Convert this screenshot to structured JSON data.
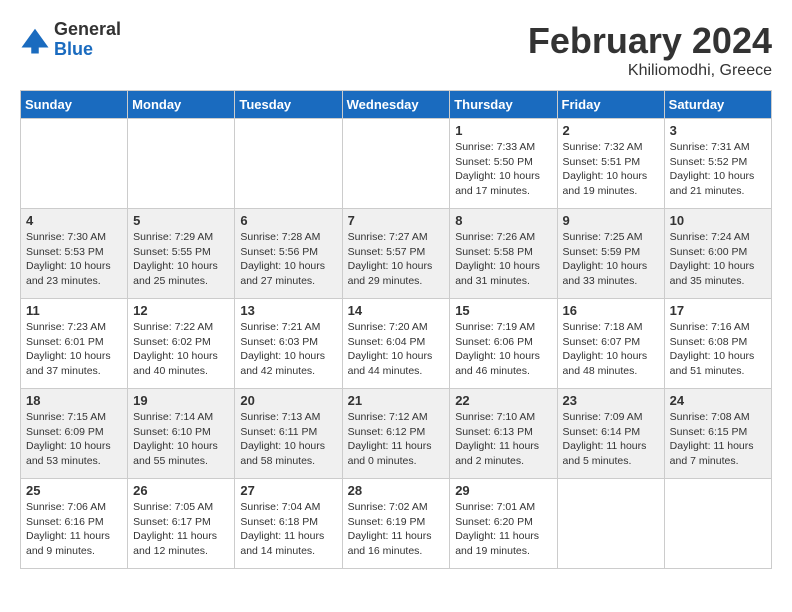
{
  "header": {
    "logo_general": "General",
    "logo_blue": "Blue",
    "month_year": "February 2024",
    "location": "Khiliomodhi, Greece"
  },
  "weekdays": [
    "Sunday",
    "Monday",
    "Tuesday",
    "Wednesday",
    "Thursday",
    "Friday",
    "Saturday"
  ],
  "weeks": [
    [
      {
        "day": "",
        "info": ""
      },
      {
        "day": "",
        "info": ""
      },
      {
        "day": "",
        "info": ""
      },
      {
        "day": "",
        "info": ""
      },
      {
        "day": "1",
        "info": "Sunrise: 7:33 AM\nSunset: 5:50 PM\nDaylight: 10 hours\nand 17 minutes."
      },
      {
        "day": "2",
        "info": "Sunrise: 7:32 AM\nSunset: 5:51 PM\nDaylight: 10 hours\nand 19 minutes."
      },
      {
        "day": "3",
        "info": "Sunrise: 7:31 AM\nSunset: 5:52 PM\nDaylight: 10 hours\nand 21 minutes."
      }
    ],
    [
      {
        "day": "4",
        "info": "Sunrise: 7:30 AM\nSunset: 5:53 PM\nDaylight: 10 hours\nand 23 minutes."
      },
      {
        "day": "5",
        "info": "Sunrise: 7:29 AM\nSunset: 5:55 PM\nDaylight: 10 hours\nand 25 minutes."
      },
      {
        "day": "6",
        "info": "Sunrise: 7:28 AM\nSunset: 5:56 PM\nDaylight: 10 hours\nand 27 minutes."
      },
      {
        "day": "7",
        "info": "Sunrise: 7:27 AM\nSunset: 5:57 PM\nDaylight: 10 hours\nand 29 minutes."
      },
      {
        "day": "8",
        "info": "Sunrise: 7:26 AM\nSunset: 5:58 PM\nDaylight: 10 hours\nand 31 minutes."
      },
      {
        "day": "9",
        "info": "Sunrise: 7:25 AM\nSunset: 5:59 PM\nDaylight: 10 hours\nand 33 minutes."
      },
      {
        "day": "10",
        "info": "Sunrise: 7:24 AM\nSunset: 6:00 PM\nDaylight: 10 hours\nand 35 minutes."
      }
    ],
    [
      {
        "day": "11",
        "info": "Sunrise: 7:23 AM\nSunset: 6:01 PM\nDaylight: 10 hours\nand 37 minutes."
      },
      {
        "day": "12",
        "info": "Sunrise: 7:22 AM\nSunset: 6:02 PM\nDaylight: 10 hours\nand 40 minutes."
      },
      {
        "day": "13",
        "info": "Sunrise: 7:21 AM\nSunset: 6:03 PM\nDaylight: 10 hours\nand 42 minutes."
      },
      {
        "day": "14",
        "info": "Sunrise: 7:20 AM\nSunset: 6:04 PM\nDaylight: 10 hours\nand 44 minutes."
      },
      {
        "day": "15",
        "info": "Sunrise: 7:19 AM\nSunset: 6:06 PM\nDaylight: 10 hours\nand 46 minutes."
      },
      {
        "day": "16",
        "info": "Sunrise: 7:18 AM\nSunset: 6:07 PM\nDaylight: 10 hours\nand 48 minutes."
      },
      {
        "day": "17",
        "info": "Sunrise: 7:16 AM\nSunset: 6:08 PM\nDaylight: 10 hours\nand 51 minutes."
      }
    ],
    [
      {
        "day": "18",
        "info": "Sunrise: 7:15 AM\nSunset: 6:09 PM\nDaylight: 10 hours\nand 53 minutes."
      },
      {
        "day": "19",
        "info": "Sunrise: 7:14 AM\nSunset: 6:10 PM\nDaylight: 10 hours\nand 55 minutes."
      },
      {
        "day": "20",
        "info": "Sunrise: 7:13 AM\nSunset: 6:11 PM\nDaylight: 10 hours\nand 58 minutes."
      },
      {
        "day": "21",
        "info": "Sunrise: 7:12 AM\nSunset: 6:12 PM\nDaylight: 11 hours\nand 0 minutes."
      },
      {
        "day": "22",
        "info": "Sunrise: 7:10 AM\nSunset: 6:13 PM\nDaylight: 11 hours\nand 2 minutes."
      },
      {
        "day": "23",
        "info": "Sunrise: 7:09 AM\nSunset: 6:14 PM\nDaylight: 11 hours\nand 5 minutes."
      },
      {
        "day": "24",
        "info": "Sunrise: 7:08 AM\nSunset: 6:15 PM\nDaylight: 11 hours\nand 7 minutes."
      }
    ],
    [
      {
        "day": "25",
        "info": "Sunrise: 7:06 AM\nSunset: 6:16 PM\nDaylight: 11 hours\nand 9 minutes."
      },
      {
        "day": "26",
        "info": "Sunrise: 7:05 AM\nSunset: 6:17 PM\nDaylight: 11 hours\nand 12 minutes."
      },
      {
        "day": "27",
        "info": "Sunrise: 7:04 AM\nSunset: 6:18 PM\nDaylight: 11 hours\nand 14 minutes."
      },
      {
        "day": "28",
        "info": "Sunrise: 7:02 AM\nSunset: 6:19 PM\nDaylight: 11 hours\nand 16 minutes."
      },
      {
        "day": "29",
        "info": "Sunrise: 7:01 AM\nSunset: 6:20 PM\nDaylight: 11 hours\nand 19 minutes."
      },
      {
        "day": "",
        "info": ""
      },
      {
        "day": "",
        "info": ""
      }
    ]
  ]
}
